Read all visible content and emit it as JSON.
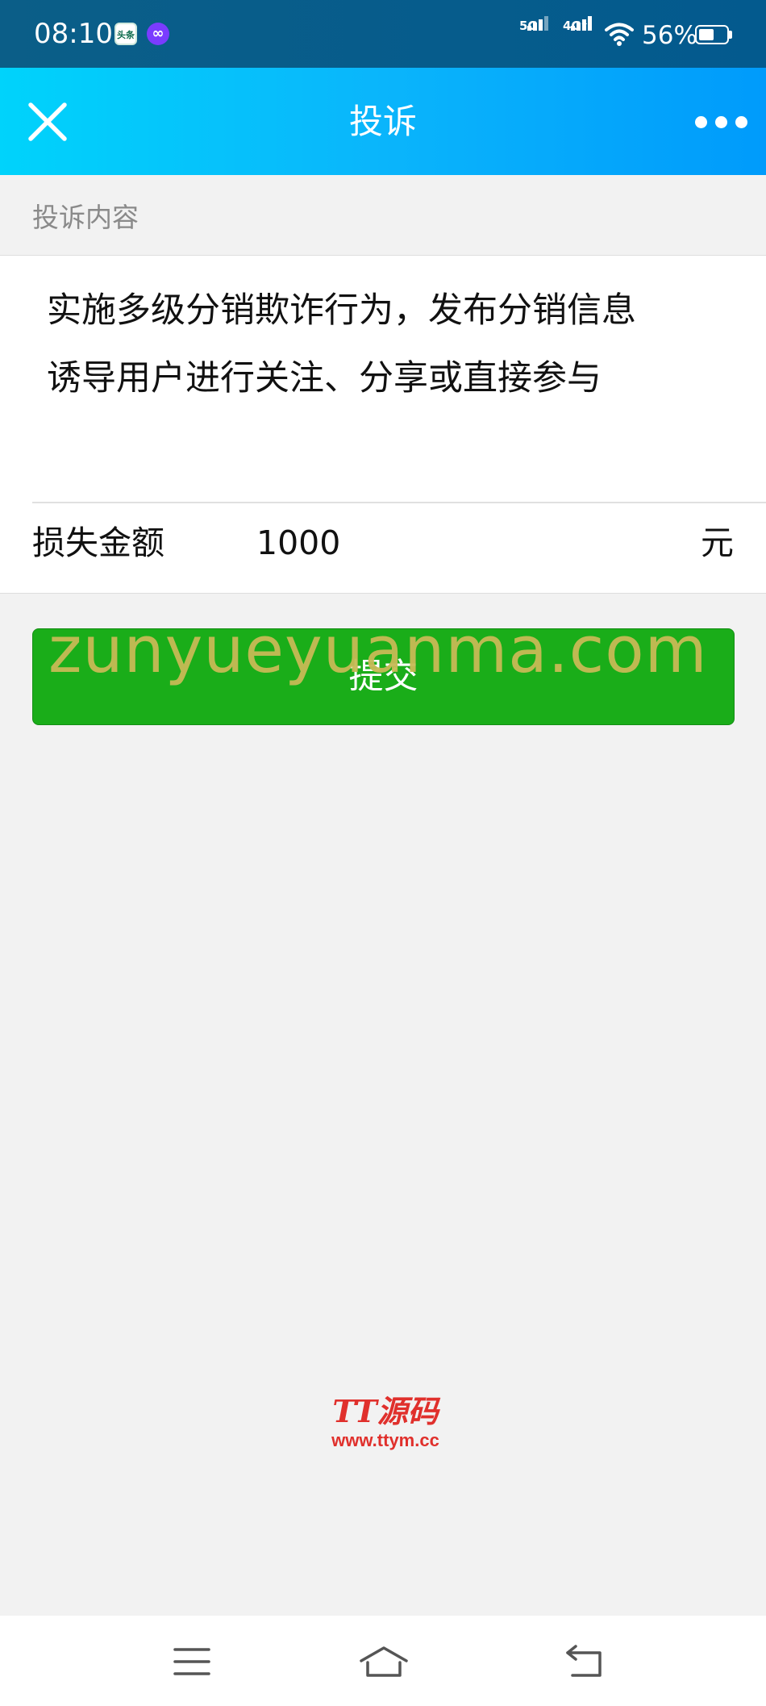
{
  "status_bar": {
    "time": "08:10",
    "app_icons": [
      "头条",
      "∞"
    ],
    "signal_1_label": "5G",
    "signal_2_label": "4G⁺",
    "battery_percent": 56,
    "battery_text": "56%"
  },
  "header": {
    "title": "投诉",
    "close_icon": "close-icon",
    "more_icon": "more-icon"
  },
  "form": {
    "content_section_label": "投诉内容",
    "content_text": "实施多级分销欺诈行为，发布分销信息\n诱导用户进行关注、分享或直接参与",
    "loss_label": "损失金额",
    "loss_value": "1000",
    "loss_unit": "元",
    "submit_label": "提交"
  },
  "watermark": {
    "text": "zunyueyuanma.com",
    "color": "#c7ba56"
  },
  "logo": {
    "main": "TT源码",
    "url": "www.ttym.cc",
    "color": "#e0302c"
  },
  "nav_bar": {
    "icons": [
      "menu-icon",
      "home-icon",
      "back-icon"
    ]
  },
  "colors": {
    "header_gradient_start": "#00d3fb",
    "header_gradient_end": "#009bfb",
    "submit_green": "#1aad19",
    "background": "#f2f2f2"
  }
}
